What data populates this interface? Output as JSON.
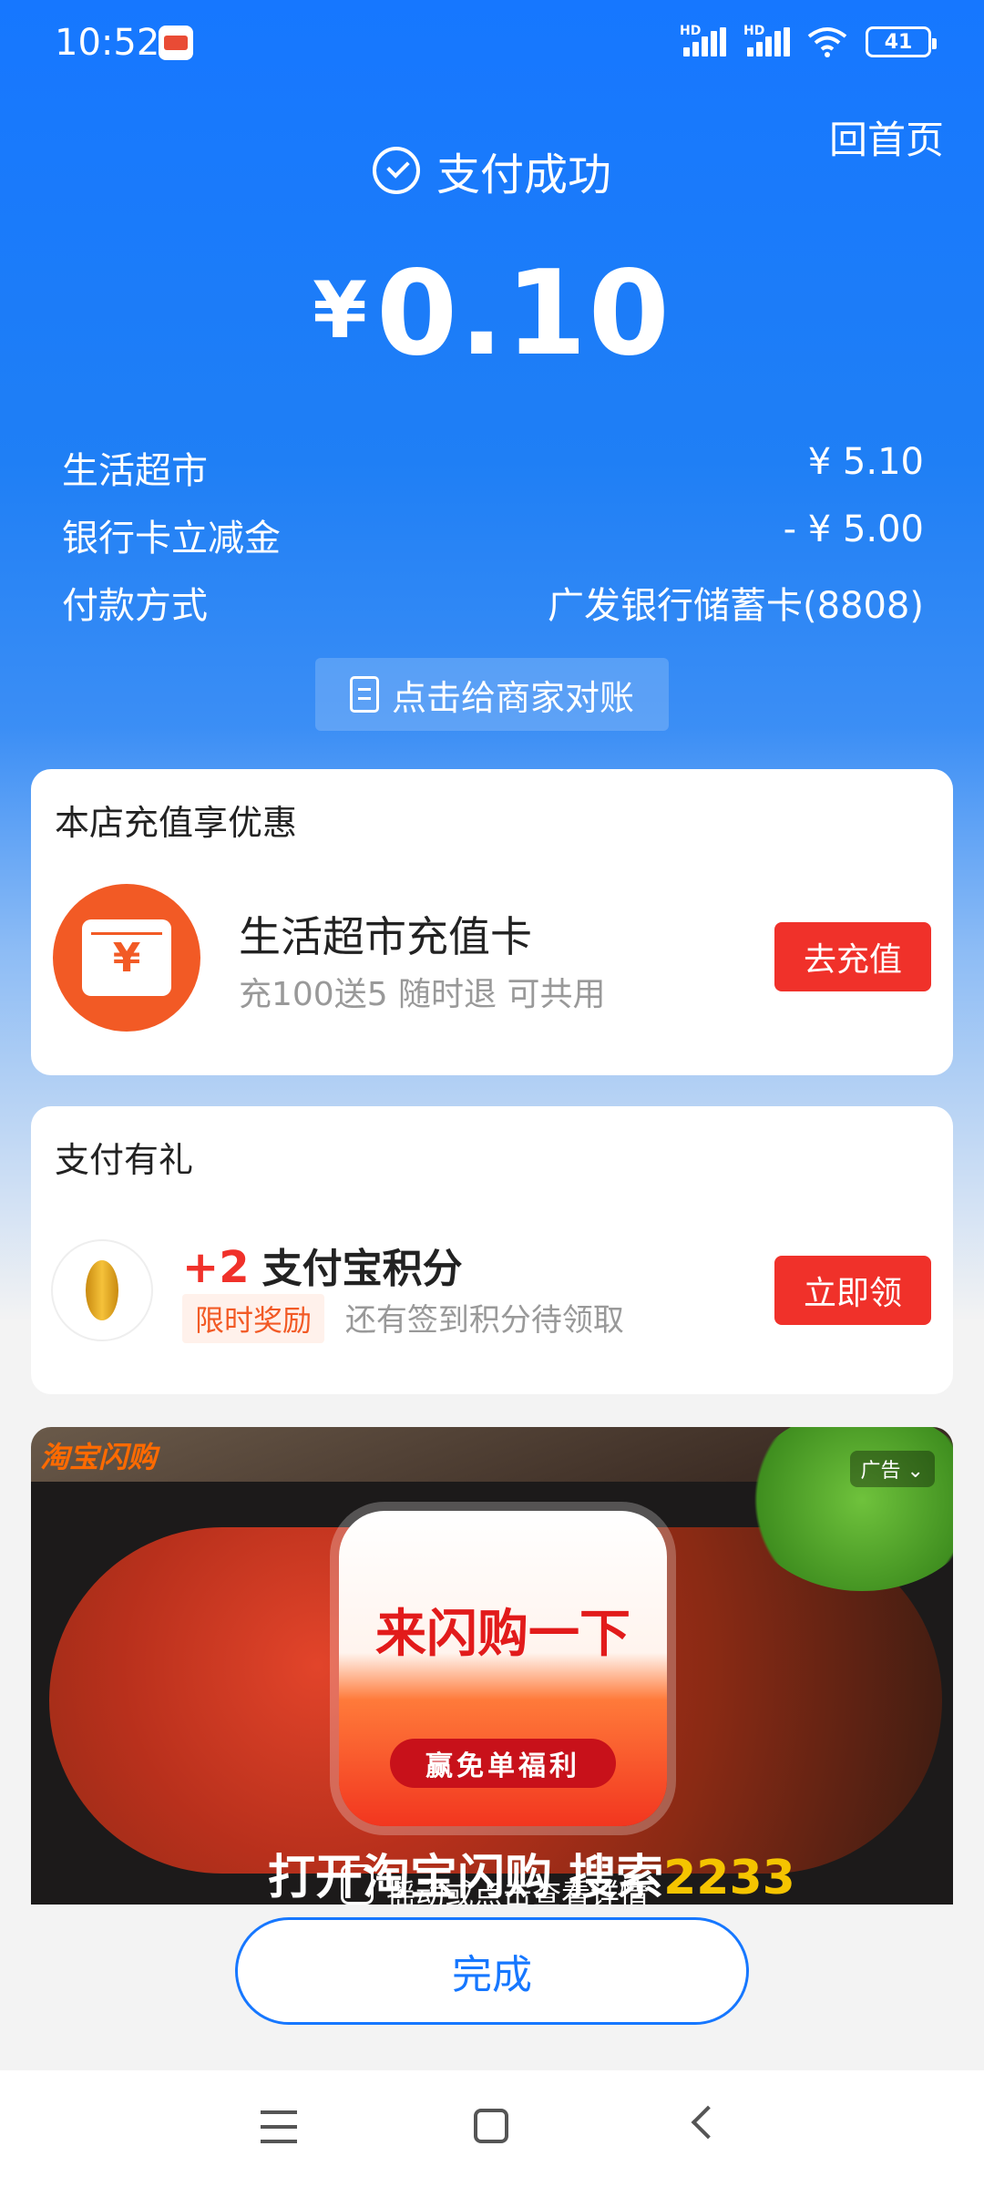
{
  "status_bar": {
    "time": "10:52",
    "battery": "41",
    "signal_label": "HD"
  },
  "header": {
    "home_link": "回首页",
    "success_text": "支付成功",
    "currency": "¥",
    "amount": "0.10"
  },
  "details": [
    {
      "label": "生活超市",
      "value": "¥ 5.10"
    },
    {
      "label": "银行卡立减金",
      "value": "- ¥ 5.00"
    },
    {
      "label": "付款方式",
      "value": "广发银行储蓄卡(8808)"
    }
  ],
  "reconcile_button": "点击给商家对账",
  "recharge_card": {
    "title": "本店充值享优惠",
    "currency_symbol": "¥",
    "item_name": "生活超市充值卡",
    "item_desc": "充100送5 随时退 可共用",
    "button": "去充值"
  },
  "reward_card": {
    "title": "支付有礼",
    "points": "+2",
    "points_label": "支付宝积分",
    "tag": "限时奖励",
    "desc": "还有签到积分待领取",
    "button": "立即领"
  },
  "ad": {
    "logo": "淘宝闪购",
    "ad_label": "广告",
    "badge_title": "来闪购一下",
    "badge_pill": "赢免单福利",
    "bottom_text": "打开淘宝闪购 搜索",
    "bottom_number": "2233",
    "hint": "摇动或点击查看详情"
  },
  "done_button": "完成",
  "colors": {
    "primary": "#1677ff",
    "red": "#f0312a",
    "orange": "#f25a25"
  }
}
